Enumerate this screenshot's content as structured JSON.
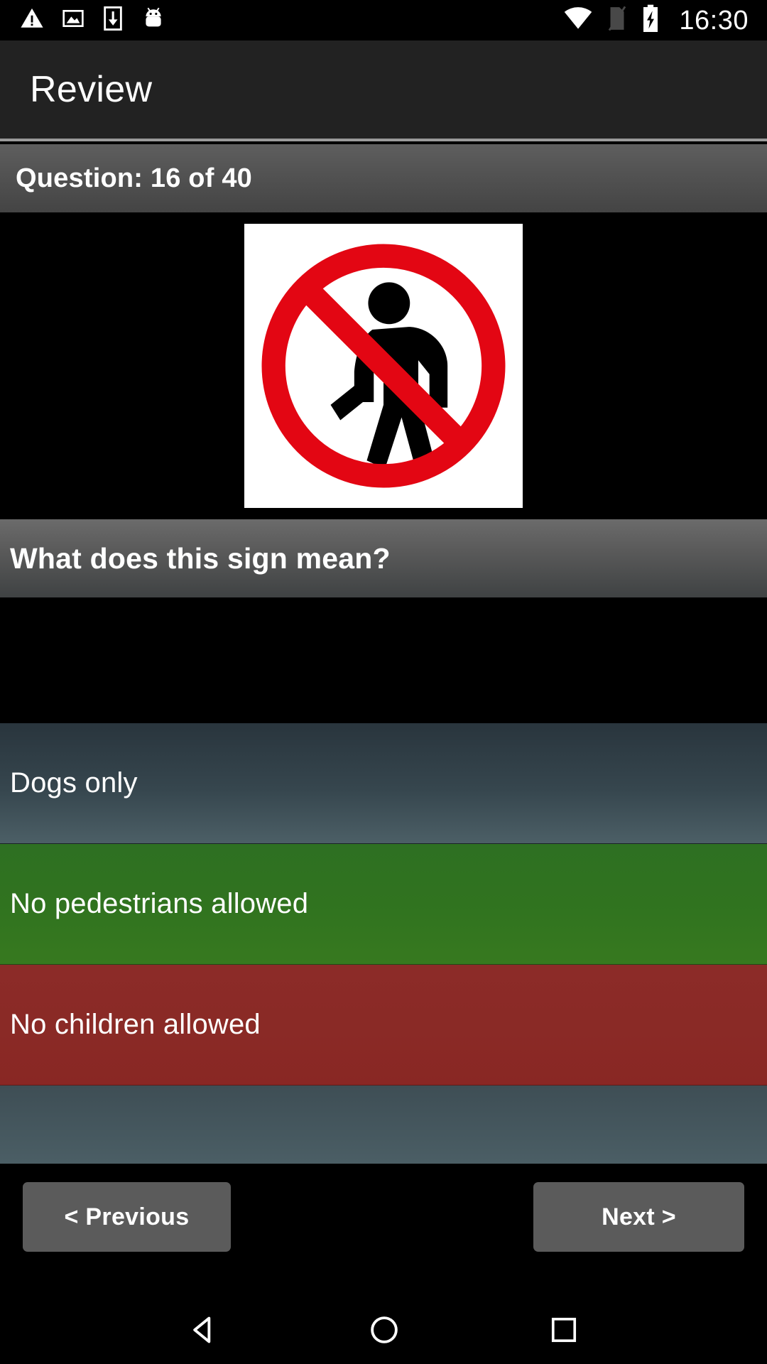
{
  "status_bar": {
    "time": "16:30",
    "icons_left": [
      "warning-triangle-icon",
      "image-icon",
      "download-icon",
      "android-icon"
    ],
    "icons_right": [
      "wifi-icon",
      "no-sim-icon",
      "battery-charging-icon"
    ]
  },
  "action_bar": {
    "title": "Review"
  },
  "counter_bar": {
    "text": "Question: 16 of 40",
    "current": 16,
    "total": 40
  },
  "sign": {
    "name": "no-pedestrians-sign",
    "background": "#ffffff",
    "ring_color": "#e30613",
    "figure_color": "#000000"
  },
  "question": {
    "text": "What does this sign mean?"
  },
  "answers": [
    {
      "label": "Dogs only",
      "state": "neutral"
    },
    {
      "label": "No pedestrians allowed",
      "state": "correct"
    },
    {
      "label": "No children allowed",
      "state": "wrong"
    },
    {
      "label": "",
      "state": "neutral2"
    }
  ],
  "nav": {
    "previous_label": "< Previous",
    "next_label": "Next >"
  },
  "system_nav": {
    "back": "back-triangle-icon",
    "home": "home-circle-icon",
    "recents": "recents-square-icon"
  },
  "colors": {
    "correct_green": "#30731f",
    "wrong_red": "#8a2a26",
    "neutral_slate": "#36464e",
    "action_bar": "#222222",
    "accent_divider": "#9a9a9a"
  }
}
